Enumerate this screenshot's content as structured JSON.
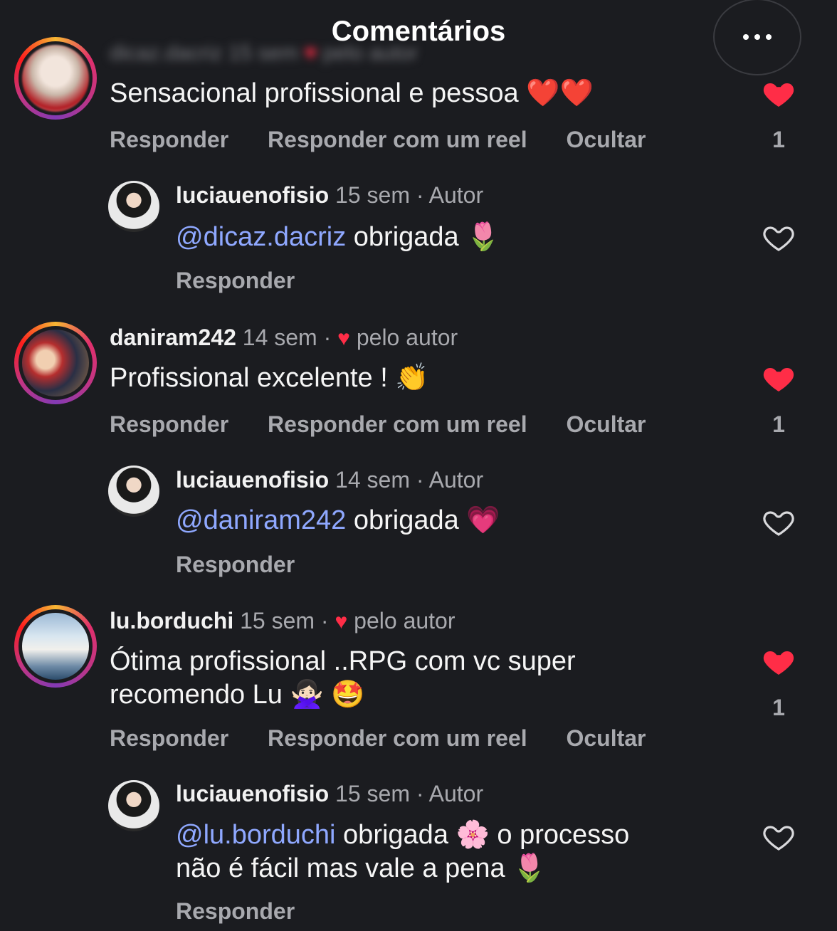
{
  "header": {
    "title": "Comentários",
    "menu_icon": "more-horizontal-icon"
  },
  "comments": [
    {
      "username": "dicaz.dacriz",
      "time": "15 sem",
      "liked_by_author": "pelo autor",
      "text": "Sensacional profissional e pessoa ❤️❤️",
      "likes": "1",
      "liked": true,
      "reply": {
        "username": "luciauenofisio",
        "time": "15 sem",
        "author_label": "Autor",
        "mention": "@dicaz.dacriz",
        "text": "obrigada 🌷",
        "reply_label": "Responder"
      }
    },
    {
      "username": "daniram242",
      "time": "14 sem",
      "liked_by_author": "pelo autor",
      "text": "Profissional excelente ! 👏",
      "likes": "1",
      "liked": true,
      "reply": {
        "username": "luciauenofisio",
        "time": "14 sem",
        "author_label": "Autor",
        "mention": "@daniram242",
        "text": "obrigada 💗",
        "reply_label": "Responder"
      }
    },
    {
      "username": "lu.borduchi",
      "time": "15 sem",
      "liked_by_author": "pelo autor",
      "text_line1": "Ótima profissional ..RPG com vc super",
      "text_line2": "recomendo Lu 🙅🏻‍♀️ 🤩",
      "likes": "1",
      "liked": true,
      "reply": {
        "username": "luciauenofisio",
        "time": "15 sem",
        "author_label": "Autor",
        "mention": "@lu.borduchi",
        "text_line1": "obrigada 🌸 o processo",
        "text_line2": "não é fácil mas vale a pena 🌷",
        "reply_label": "Responder"
      }
    }
  ],
  "actions": {
    "reply": "Responder",
    "reply_reel": "Responder com um reel",
    "hide": "Ocultar"
  },
  "separator": "·",
  "colors": {
    "background": "#1b1c20",
    "like_red": "#ff2d47",
    "mention_blue": "#8fa8ff",
    "muted": "#a8a9ae"
  }
}
